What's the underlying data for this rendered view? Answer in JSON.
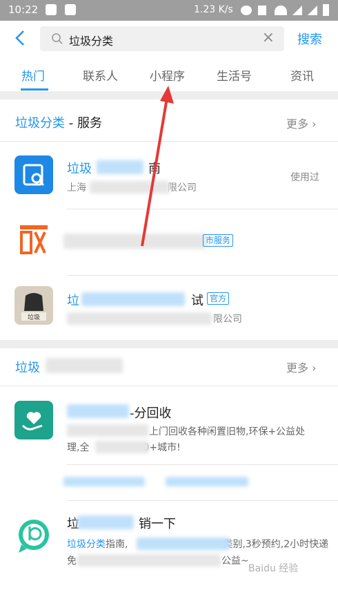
{
  "status": {
    "time": "10:22",
    "speed": "1.23 K/s"
  },
  "search": {
    "value": "垃圾分类",
    "button": "搜索"
  },
  "tabs": [
    "热门",
    "联系人",
    "小程序",
    "生活号",
    "资讯"
  ],
  "services": {
    "title_blue": "垃圾分类",
    "title_rest": " - 服务",
    "more": "更多 ›",
    "items": [
      {
        "name_blue": "垃圾",
        "name_rest": "南",
        "sub": "上海",
        "sub_tail": "限公司",
        "tag": "使用过"
      },
      {
        "badge_tail": "市服务"
      },
      {
        "name_blue": "垃",
        "name_rest": "试",
        "badge": "官方",
        "sub_tail": "限公司"
      }
    ]
  },
  "life": {
    "title_blue": "垃圾",
    "more": "更多 ›",
    "items": [
      {
        "name_tail": "-分回收",
        "desc1_tail": "上门回收各种闲置旧物,环保+公益处",
        "desc2": "理,全",
        "desc2_tail": "0+城市!"
      },
      {
        "name_head": "垃",
        "name_tail": "销一下",
        "desc1": "垃圾分类",
        "desc1_mid": "指南,",
        "desc1_tail": "类别,3秒预约,2小时快递",
        "desc2": "免",
        "desc2_tail": "公益~"
      }
    ]
  },
  "watermark": "Baidu 经验",
  "colors": {
    "accent": "#2196f3",
    "arrow": "#e53935"
  }
}
